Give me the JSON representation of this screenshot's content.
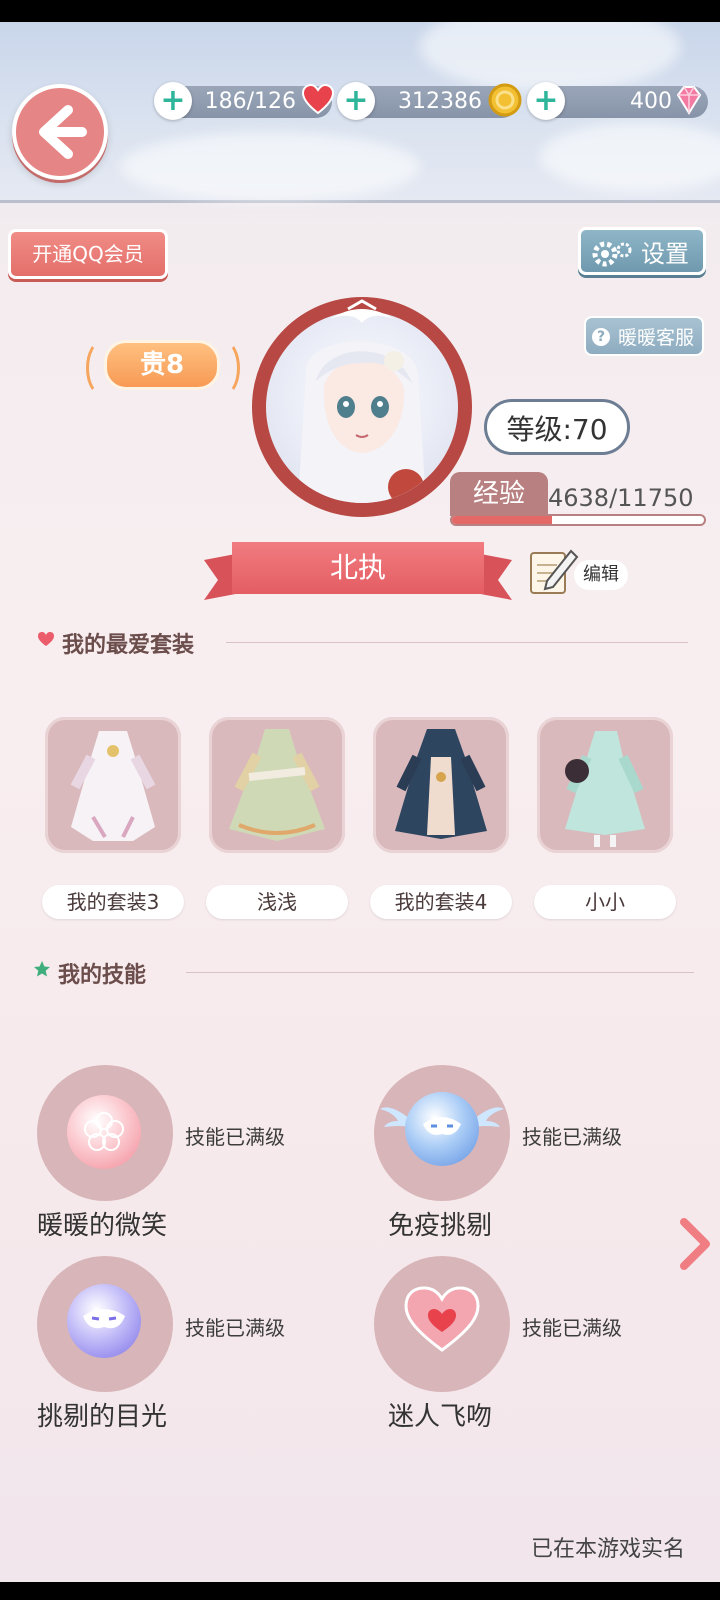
{
  "resources": {
    "stamina": "186/126",
    "gold": "312386",
    "diamonds": "400"
  },
  "buttons": {
    "qq_member": "开通QQ会员",
    "settings": "设置",
    "customer_service": "暖暖客服",
    "edit": "编辑"
  },
  "profile": {
    "vip": "贵8",
    "level": "等级:70",
    "exp_label": "经验",
    "exp_value": "4638/11750",
    "exp_fraction": 0.395,
    "name": "北执"
  },
  "favorites": {
    "title": "我的最爱套装",
    "outfits": [
      {
        "label": "我的套装3"
      },
      {
        "label": "浅浅"
      },
      {
        "label": "我的套装4"
      },
      {
        "label": "小小"
      }
    ]
  },
  "skills": {
    "title": "我的技能",
    "items": [
      {
        "name": "暖暖的微笑",
        "status": "技能已满级",
        "icon": "flower-icon"
      },
      {
        "name": "免疫挑剔",
        "status": "技能已满级",
        "icon": "winged-mask-icon"
      },
      {
        "name": "挑剔的目光",
        "status": "技能已满级",
        "icon": "mask-icon"
      },
      {
        "name": "迷人飞吻",
        "status": "技能已满级",
        "icon": "heart-icon"
      }
    ]
  },
  "footer": "已在本游戏实名",
  "colors": {
    "accent": "#e46866",
    "teal": "#2fb59a",
    "vip_orange": "#f79a55"
  }
}
